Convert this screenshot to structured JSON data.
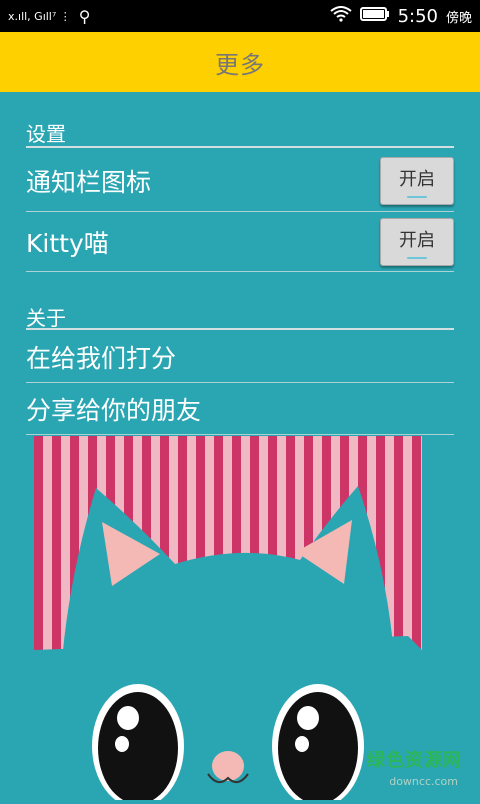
{
  "status": {
    "left_indicators": "x.ıll, Gıll⁷ ⋮",
    "time": "5:50",
    "ampm": "傍晚"
  },
  "header": {
    "title": "更多"
  },
  "settings": {
    "section_title": "设置",
    "items": [
      {
        "label": "通知栏图标",
        "toggle": "开启"
      },
      {
        "label": "Kitty喵",
        "toggle": "开启"
      }
    ]
  },
  "about": {
    "section_title": "关于",
    "items": [
      {
        "label": "在给我们打分"
      },
      {
        "label": "分享给你的朋友"
      }
    ]
  },
  "watermark": {
    "text": "绿色资源网",
    "sub": "downcc.com"
  },
  "colors": {
    "background": "#2aa6b3",
    "header": "#ffd000",
    "stripe_red": "#cc3566",
    "stripe_pink": "#f0b8c2",
    "cat": "#2aa6b3"
  }
}
